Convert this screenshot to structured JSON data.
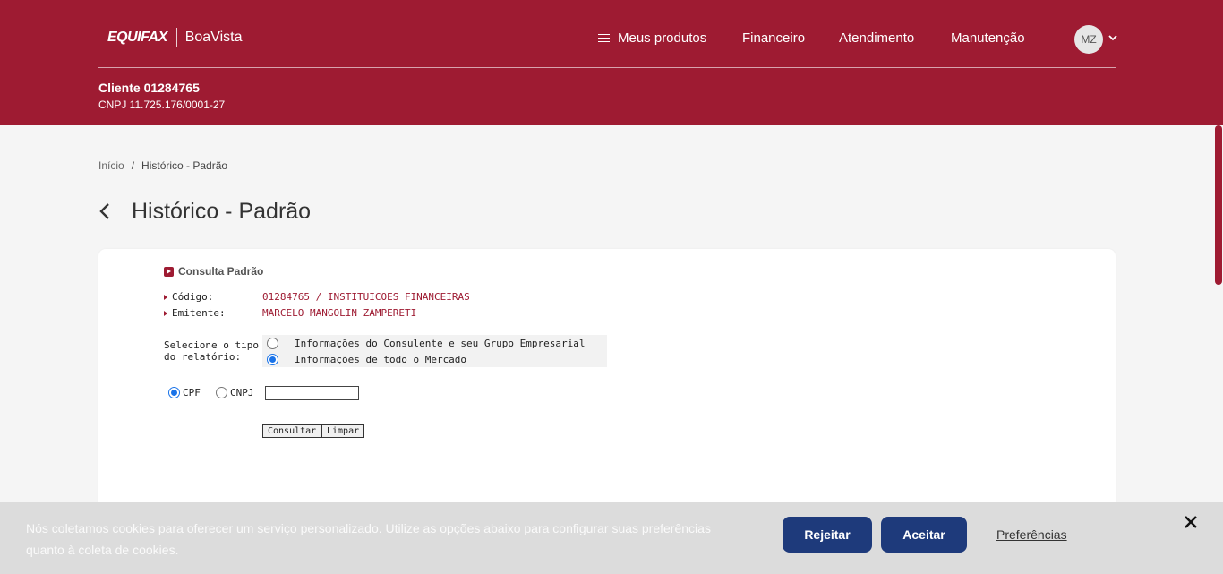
{
  "header": {
    "logo_equifax": "EQUIFAX",
    "logo_boavista": "BoaVista",
    "nav": {
      "products": "Meus produtos",
      "financeiro": "Financeiro",
      "atendimento": "Atendimento",
      "manutencao": "Manutenção"
    },
    "avatar_initials": "MZ",
    "client_name": "Cliente 01284765",
    "client_cnpj": "CNPJ 11.725.176/0001-27"
  },
  "breadcrumb": {
    "home": "Início",
    "separator": "/",
    "current": "Histórico - Padrão"
  },
  "page_title": "Histórico - Padrão",
  "form": {
    "section_title": "Consulta Padrão",
    "codigo_label": "Código:",
    "codigo_value": "01284765 / INSTITUICOES FINANCEIRAS",
    "emitente_label": "Emitente:",
    "emitente_value": "MARCELO MANGOLIN ZAMPERETI",
    "select_label": "Selecione o tipo do relatório:",
    "options": [
      {
        "label": "Informações do Consulente e seu Grupo Empresarial",
        "checked": false
      },
      {
        "label": "Informações de todo o Mercado",
        "checked": true
      }
    ],
    "doc_types": [
      {
        "label": "CPF",
        "checked": true
      },
      {
        "label": "CNPJ",
        "checked": false
      }
    ],
    "doc_value": "",
    "consultar_label": "Consultar",
    "limpar_label": "Limpar"
  },
  "cookie": {
    "text": "Nós coletamos cookies para oferecer um serviço personalizado. Utilize as opções abaixo para configurar suas preferências quanto à coleta de cookies.",
    "reject_label": "Rejeitar",
    "accept_label": "Aceitar",
    "prefs_label": "Preferências"
  },
  "colors": {
    "brand": "#9e1b32",
    "cookie_button": "#1e3a7b",
    "radio_checked": "#1a73e8"
  }
}
